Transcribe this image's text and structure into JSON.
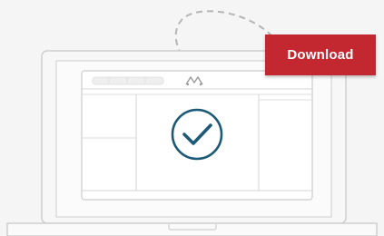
{
  "download_button": {
    "label": "Download"
  },
  "icons": {
    "app_logo": "app-logo-icon",
    "check": "checkmark-circle-icon",
    "arrow": "dashed-curved-arrow-icon"
  },
  "colors": {
    "accent": "#c3272f",
    "check": "#1d5a78",
    "outline": "#c8c8c8",
    "background": "#f5f5f5"
  }
}
